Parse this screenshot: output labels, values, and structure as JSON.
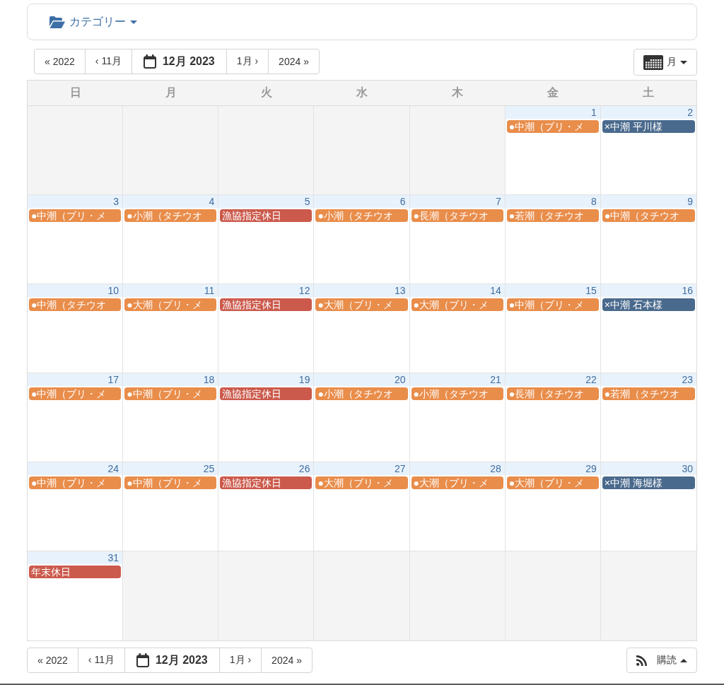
{
  "category_menu": {
    "label": "カテゴリー"
  },
  "top_nav": [
    {
      "kind": "step",
      "label": "« 2022"
    },
    {
      "kind": "step",
      "label": "‹ 11月"
    },
    {
      "kind": "current",
      "label": "12月 2023"
    },
    {
      "kind": "step",
      "label": "1月 ›"
    },
    {
      "kind": "step",
      "label": "2024 »"
    }
  ],
  "view_menu": {
    "label": "月"
  },
  "weekdays": [
    "日",
    "月",
    "火",
    "水",
    "木",
    "金",
    "土"
  ],
  "weeks": [
    {
      "days": [
        {
          "in_month": false
        },
        {
          "in_month": false
        },
        {
          "in_month": false
        },
        {
          "in_month": false
        },
        {
          "in_month": false
        },
        {
          "in_month": true,
          "date": "1",
          "events": [
            {
              "title": "●中潮（ブリ・メ",
              "color": "#e98d4b"
            }
          ]
        },
        {
          "in_month": true,
          "date": "2",
          "events": [
            {
              "title": "×中潮 平川様",
              "color": "#4a6a8d"
            }
          ]
        }
      ]
    },
    {
      "days": [
        {
          "in_month": true,
          "date": "3",
          "events": [
            {
              "title": "●中潮（ブリ・メ",
              "color": "#e98d4b"
            }
          ]
        },
        {
          "in_month": true,
          "date": "4",
          "events": [
            {
              "title": "●小潮（タチウオ",
              "color": "#e98d4b"
            }
          ]
        },
        {
          "in_month": true,
          "date": "5",
          "events": [
            {
              "title": "漁協指定休日",
              "color": "#cb5a4c"
            }
          ]
        },
        {
          "in_month": true,
          "date": "6",
          "events": [
            {
              "title": "●小潮（タチウオ",
              "color": "#e98d4b"
            }
          ]
        },
        {
          "in_month": true,
          "date": "7",
          "events": [
            {
              "title": "●長潮（タチウオ",
              "color": "#e98d4b"
            }
          ]
        },
        {
          "in_month": true,
          "date": "8",
          "events": [
            {
              "title": "●若潮（タチウオ",
              "color": "#e98d4b"
            }
          ]
        },
        {
          "in_month": true,
          "date": "9",
          "events": [
            {
              "title": "●中潮（タチウオ",
              "color": "#e98d4b"
            }
          ]
        }
      ]
    },
    {
      "days": [
        {
          "in_month": true,
          "date": "10",
          "events": [
            {
              "title": "●中潮（タチウオ",
              "color": "#e98d4b"
            }
          ]
        },
        {
          "in_month": true,
          "date": "11",
          "events": [
            {
              "title": "●大潮（ブリ・メ",
              "color": "#e98d4b"
            }
          ]
        },
        {
          "in_month": true,
          "date": "12",
          "events": [
            {
              "title": "漁協指定休日",
              "color": "#cb5a4c"
            }
          ]
        },
        {
          "in_month": true,
          "date": "13",
          "events": [
            {
              "title": "●大潮（ブリ・メ",
              "color": "#e98d4b"
            }
          ]
        },
        {
          "in_month": true,
          "date": "14",
          "events": [
            {
              "title": "●大潮（ブリ・メ",
              "color": "#e98d4b"
            }
          ]
        },
        {
          "in_month": true,
          "date": "15",
          "events": [
            {
              "title": "●中潮（ブリ・メ",
              "color": "#e98d4b"
            }
          ]
        },
        {
          "in_month": true,
          "date": "16",
          "events": [
            {
              "title": "×中潮 石本様",
              "color": "#4a6a8d"
            }
          ]
        }
      ]
    },
    {
      "days": [
        {
          "in_month": true,
          "date": "17",
          "events": [
            {
              "title": "●中潮（ブリ・メ",
              "color": "#e98d4b"
            }
          ]
        },
        {
          "in_month": true,
          "date": "18",
          "events": [
            {
              "title": "●中潮（ブリ・メ",
              "color": "#e98d4b"
            }
          ]
        },
        {
          "in_month": true,
          "date": "19",
          "events": [
            {
              "title": "漁協指定休日",
              "color": "#cb5a4c"
            }
          ]
        },
        {
          "in_month": true,
          "date": "20",
          "events": [
            {
              "title": "●小潮（タチウオ",
              "color": "#e98d4b"
            }
          ]
        },
        {
          "in_month": true,
          "date": "21",
          "events": [
            {
              "title": "●小潮（タチウオ",
              "color": "#e98d4b"
            }
          ]
        },
        {
          "in_month": true,
          "date": "22",
          "events": [
            {
              "title": "●長潮（タチウオ",
              "color": "#e98d4b"
            }
          ]
        },
        {
          "in_month": true,
          "date": "23",
          "events": [
            {
              "title": "●若潮（タチウオ",
              "color": "#e98d4b"
            }
          ]
        }
      ]
    },
    {
      "days": [
        {
          "in_month": true,
          "date": "24",
          "events": [
            {
              "title": "●中潮（ブリ・メ",
              "color": "#e98d4b"
            }
          ]
        },
        {
          "in_month": true,
          "date": "25",
          "events": [
            {
              "title": "●中潮（ブリ・メ",
              "color": "#e98d4b"
            }
          ]
        },
        {
          "in_month": true,
          "date": "26",
          "events": [
            {
              "title": "漁協指定休日",
              "color": "#cb5a4c"
            }
          ]
        },
        {
          "in_month": true,
          "date": "27",
          "events": [
            {
              "title": "●大潮（ブリ・メ",
              "color": "#e98d4b"
            }
          ]
        },
        {
          "in_month": true,
          "date": "28",
          "events": [
            {
              "title": "●大潮（ブリ・メ",
              "color": "#e98d4b"
            }
          ]
        },
        {
          "in_month": true,
          "date": "29",
          "events": [
            {
              "title": "●大潮（ブリ・メ",
              "color": "#e98d4b"
            }
          ]
        },
        {
          "in_month": true,
          "date": "30",
          "events": [
            {
              "title": "×中潮 海堀様",
              "color": "#4a6a8d"
            }
          ]
        }
      ]
    },
    {
      "days": [
        {
          "in_month": true,
          "date": "31",
          "events": [
            {
              "title": "年末休日",
              "color": "#cb5a4c"
            }
          ]
        },
        {
          "in_month": false
        },
        {
          "in_month": false
        },
        {
          "in_month": false
        },
        {
          "in_month": false
        },
        {
          "in_month": false
        },
        {
          "in_month": false
        }
      ]
    }
  ],
  "bottom_nav": [
    {
      "kind": "step",
      "label": "« 2022"
    },
    {
      "kind": "step",
      "label": "‹ 11月"
    },
    {
      "kind": "current",
      "label": "12月 2023"
    },
    {
      "kind": "step",
      "label": "1月 ›"
    },
    {
      "kind": "step",
      "label": "2024 »"
    }
  ],
  "subscribe_menu": {
    "label": "購読"
  }
}
